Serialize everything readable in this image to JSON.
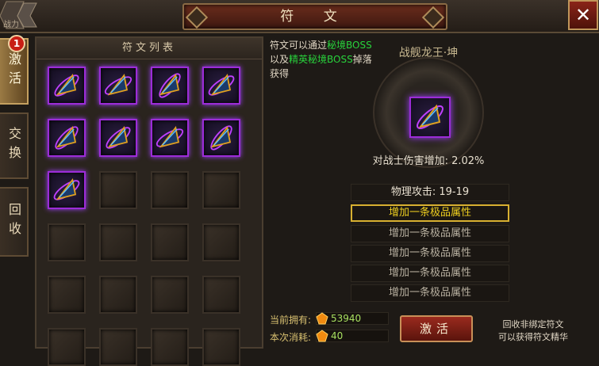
{
  "header": {
    "title": "符 文",
    "back_label": "战力"
  },
  "close_icon": "close-icon",
  "tabs": [
    {
      "label": "激活",
      "active": true,
      "badge": "1"
    },
    {
      "label": "交换",
      "active": false
    },
    {
      "label": "回收",
      "active": false
    }
  ],
  "rune_list": {
    "title": "符文列表",
    "filled_count": 9,
    "total_visible_slots": 24
  },
  "description": {
    "prefix": "符文可以通过",
    "boss1": "秘境BOSS",
    "middle": "以及",
    "boss2": "精英秘境BOSS",
    "suffix": "掉落获得"
  },
  "selected_rune": {
    "name": "战舰龙王·坤",
    "bonus": "对战士伤害增加: 2.02%"
  },
  "attributes": [
    {
      "label": "物理攻击: 19-19",
      "type": "stat"
    },
    {
      "label": "增加一条极品属性",
      "type": "selected"
    },
    {
      "label": "增加一条极品属性",
      "type": "normal"
    },
    {
      "label": "增加一条极品属性",
      "type": "normal"
    },
    {
      "label": "增加一条极品属性",
      "type": "normal"
    },
    {
      "label": "增加一条极品属性",
      "type": "normal"
    }
  ],
  "resources": {
    "owned_label": "当前拥有:",
    "owned_value": "53940",
    "cost_label": "本次消耗:",
    "cost_value": "40"
  },
  "activate_button": "激活",
  "recycle_tip": {
    "line1": "回收非绑定符文",
    "line2": "可以获得符文精华"
  },
  "colors": {
    "highlight_green": "#28d23c",
    "rune_border": "#9c2cd8",
    "selected_border": "#d8b030"
  }
}
